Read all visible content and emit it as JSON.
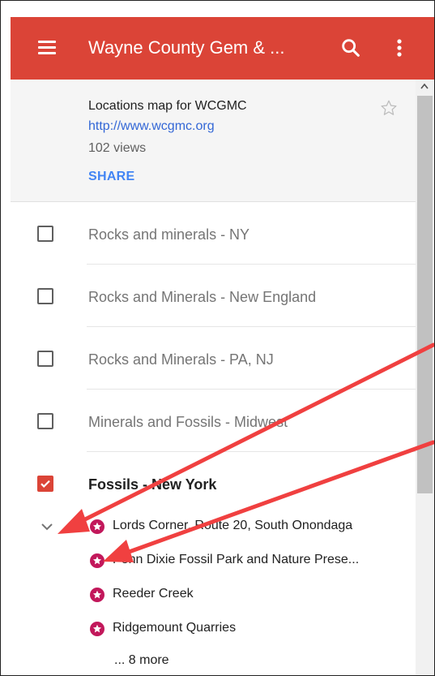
{
  "header": {
    "title": "Wayne County Gem & ...",
    "background": "#db4437",
    "menu_icon": "menu-icon",
    "search_icon": "search-icon",
    "more_icon": "more-vert-icon"
  },
  "map_info": {
    "description": "Locations map for WCGMC",
    "url": "http://www.wcgmc.org",
    "views": "102 views",
    "share_label": "SHARE",
    "star_icon": "star-outline-icon"
  },
  "layers": [
    {
      "label": "Rocks and minerals - NY",
      "checked": false
    },
    {
      "label": "Rocks and Minerals - New England",
      "checked": false
    },
    {
      "label": "Rocks and Minerals - PA, NJ",
      "checked": false
    },
    {
      "label": "Minerals and Fossils - Midwest",
      "checked": false
    },
    {
      "label": "Fossils - New York",
      "checked": true
    }
  ],
  "places": [
    {
      "name": "Lords Corner, Route 20, South Onondaga"
    },
    {
      "name": "Penn Dixie Fossil Park and Nature Prese..."
    },
    {
      "name": "Reeder Creek"
    },
    {
      "name": "Ridgemount Quarries"
    }
  ],
  "more_places": "... 8 more",
  "colors": {
    "accent": "#db4437",
    "link": "#3367d6",
    "share": "#4285f4",
    "place_pin": "#c2185b",
    "annotation_arrow": "#f04040"
  }
}
